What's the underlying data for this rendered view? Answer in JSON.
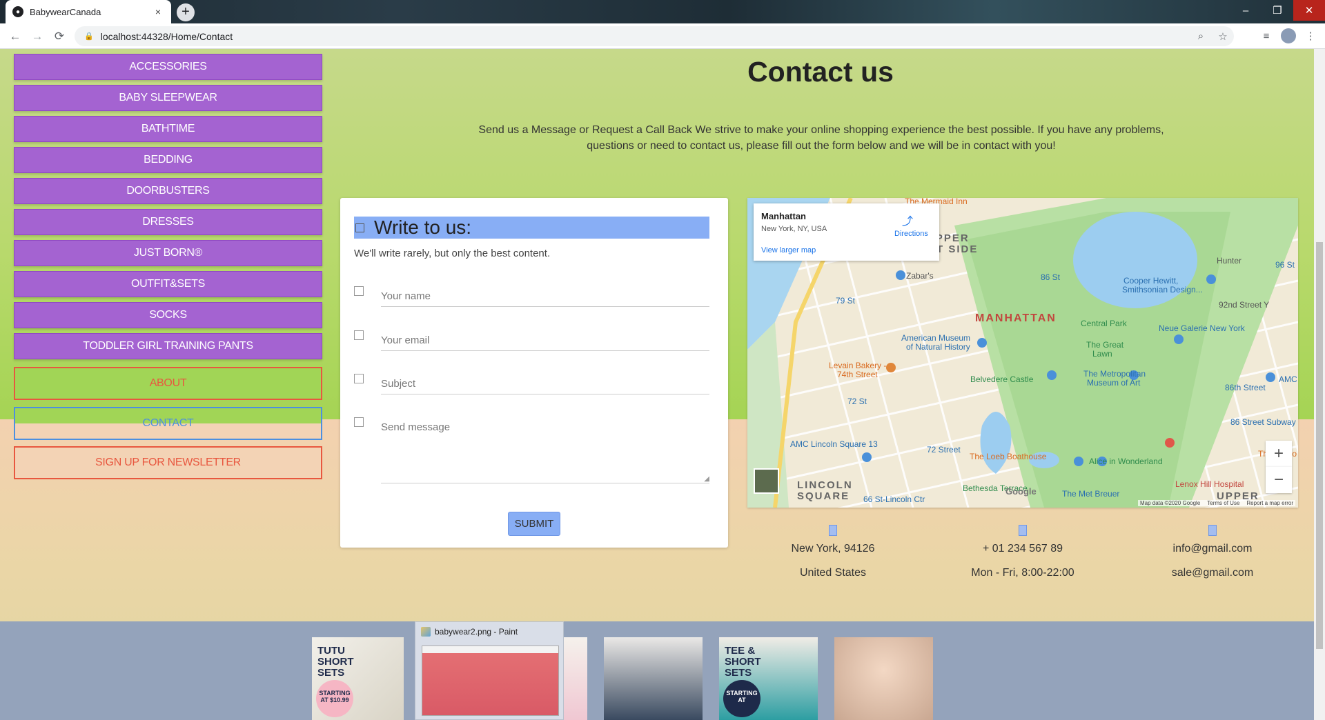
{
  "browser": {
    "tab_title": "BabywearCanada",
    "tab_close": "×",
    "new_tab": "+",
    "url": "localhost:44328/Home/Contact",
    "back": "←",
    "forward": "→",
    "reload": "⟳",
    "lock": "🔒",
    "zoom_icon": "⌕",
    "star_icon": "☆",
    "win_min": "–",
    "win_max": "❐",
    "win_close": "✕"
  },
  "sidebar": {
    "categories": [
      "ACCESSORIES",
      "BABY SLEEPWEAR",
      "BATHTIME",
      "BEDDING",
      "DOORBUSTERS",
      "DRESSES",
      "JUST BORN®",
      "OUTFIT&SETS",
      "SOCKS",
      "TODDLER GIRL TRAINING PANTS"
    ],
    "about": "ABOUT",
    "contact": "CONTACT",
    "newsletter": "SIGN UP FOR NEWSLETTER"
  },
  "main": {
    "title": "Contact us",
    "intro": "Send us a Message or Request a Call Back We strive to make your online shopping experience the best possible. If you have any problems, questions or need to contact us, please fill out the form below and we will be in contact with you!"
  },
  "form": {
    "title": "Write to us:",
    "subtitle": "We'll write rarely, but only the best content.",
    "name_placeholder": "Your name",
    "email_placeholder": "Your email",
    "subject_placeholder": "Subject",
    "message_placeholder": "Send message",
    "submit": "SUBMIT"
  },
  "map": {
    "place_title": "Manhattan",
    "place_sub": "New York, NY, USA",
    "directions": "Directions",
    "larger_map": "View larger map",
    "zoom_in": "+",
    "zoom_out": "−",
    "google": "Google",
    "footer": [
      "Map data ©2020 Google",
      "Terms of Use",
      "Report a map error"
    ],
    "labels": {
      "manhattan": "MANHATTAN",
      "upper_west": "UPPER",
      "west_side": "EST SIDE",
      "lincoln": "LINCOLN",
      "square": "SQUARE",
      "upper_east": "UPPER",
      "zabars": "Zabar's",
      "st79": "79 St",
      "st86": "86 St",
      "st86b": "86th Street",
      "st72": "72 St",
      "st72b": "72 Street",
      "amnh1": "American Museum",
      "amnh2": "of Natural History",
      "levain1": "Levain Bakery -",
      "levain2": "74th Street",
      "central_park": "Central Park",
      "great_lawn1": "The Great",
      "great_lawn2": "Lawn",
      "belvedere": "Belvedere Castle",
      "met1": "The Metropolitan",
      "met2": "Museum of Art",
      "loeb": "The Loeb Boathouse",
      "alice": "Alice in Wonderland",
      "bethesda": "Bethesda Terrace",
      "metbreuer": "The Met Breuer",
      "lenox": "Lenox Hill Hospital",
      "amc": "AMC Lincoln Square 13",
      "cooper1": "Cooper Hewitt,",
      "cooper2": "Smithsonian Design...",
      "hunter": "Hunter",
      "st92": "92nd Street Y",
      "neue": "Neue Galerie New York",
      "subway86": "86 Street Subway",
      "penrose": "The Penro",
      "amc2": "AMC",
      "st66": "66 St-Lincoln Ctr",
      "mermaid": "The Mermaid Inn",
      "st96": "96 St"
    }
  },
  "contact_info": {
    "address_line1": "New York, 94126",
    "address_line2": "United States",
    "phone_line1": "+ 01 234 567 89",
    "phone_line2": "Mon - Fri, 8:00-22:00",
    "email_line1": "info@gmail.com",
    "email_line2": "sale@gmail.com"
  },
  "footer": {
    "thumb1_title": "TUTU SHORT SETS",
    "thumb1_badge": "STARTING AT $10.99",
    "thumb4_title": "TEE & SHORT SETS",
    "thumb4_badge": "STARTING AT",
    "preview_title": "babywear2.png - Paint"
  }
}
